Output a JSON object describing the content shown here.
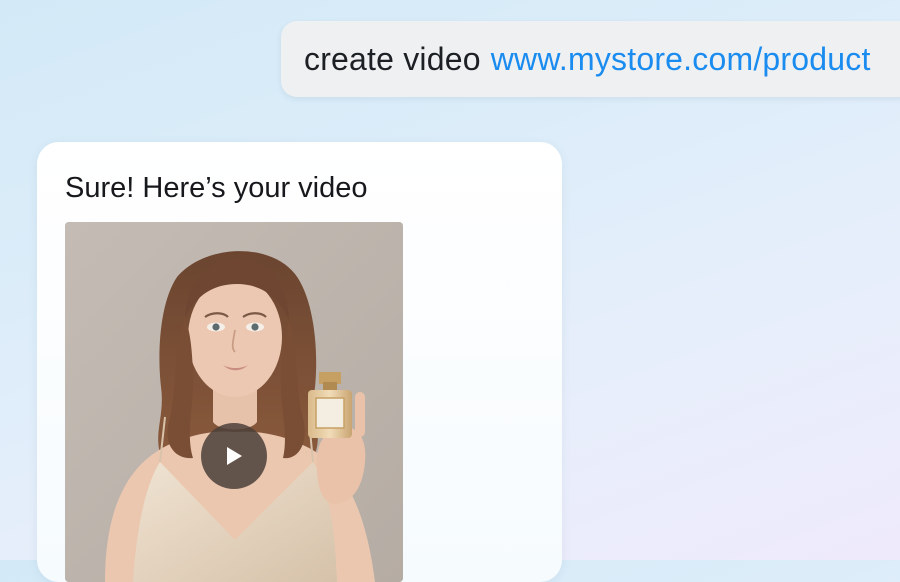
{
  "user_message": {
    "command": "create video",
    "link": "www.mystore.com/product"
  },
  "assistant_message": {
    "text": "Sure! Here’s your video"
  },
  "video": {
    "play_icon": "play-icon",
    "thumbnail_icon": "woman-holding-perfume-image"
  },
  "colors": {
    "link": "#1a8cf0",
    "user_bubble": "#eef0f2",
    "card": "#ffffff",
    "play_button": "#4b403a"
  }
}
